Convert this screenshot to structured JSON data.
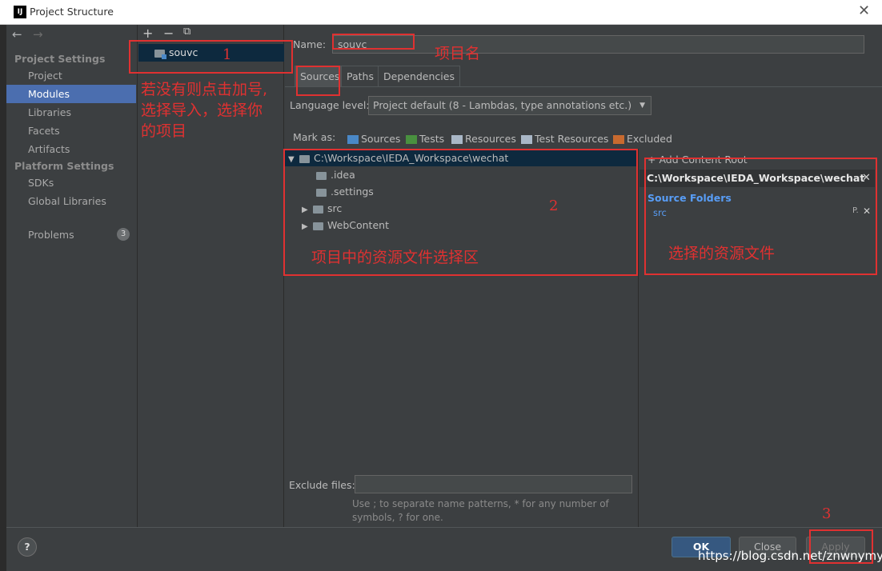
{
  "window": {
    "app_icon_text": "IJ",
    "title": "Project Structure",
    "close_glyph": "✕"
  },
  "nav": {
    "back": "←",
    "forward": "→",
    "project_settings_title": "Project Settings",
    "project_settings": [
      "Project",
      "Modules",
      "Libraries",
      "Facets",
      "Artifacts"
    ],
    "platform_settings_title": "Platform Settings",
    "platform_settings": [
      "SDKs",
      "Global Libraries"
    ],
    "problems_label": "Problems",
    "problems_count": "3",
    "selected": "Modules"
  },
  "modules": {
    "toolbar": {
      "add": "+",
      "remove": "−",
      "copy": "⧉"
    },
    "items": [
      "souvc"
    ]
  },
  "module_settings": {
    "name_label": "Name:",
    "name_value": "souvc",
    "tabs": [
      "Sources",
      "Paths",
      "Dependencies"
    ],
    "active_tab": "Sources",
    "language_level_label": "Language level:",
    "language_level_value": "Project default (8 - Lambdas, type annotations etc.)",
    "mark_as_label": "Mark as:",
    "mark_as": [
      {
        "label": "Sources",
        "color": "#4a88c7"
      },
      {
        "label": "Tests",
        "color": "#49903f"
      },
      {
        "label": "Resources",
        "color": "#a9b7c6"
      },
      {
        "label": "Test Resources",
        "color": "#a9b7c6"
      },
      {
        "label": "Excluded",
        "color": "#c86a2f"
      }
    ],
    "tree": {
      "root": "C:\\Workspace\\IEDA_Workspace\\wechat",
      "children": [
        ".idea",
        ".settings",
        "src",
        "WebContent"
      ]
    },
    "content_root": {
      "add_label": "Add Content Root",
      "path": "C:\\Workspace\\IEDA_Workspace\\wechat",
      "source_folders_title": "Source Folders",
      "source_folders": [
        "src"
      ]
    },
    "exclude_files_label": "Exclude files:",
    "exclude_files_value": "",
    "exclude_hint_line1": "Use ; to separate name patterns, * for any number of",
    "exclude_hint_line2": "symbols, ? for one."
  },
  "footer": {
    "help": "?",
    "ok": "OK",
    "close": "Close",
    "apply": "Apply"
  },
  "annotations": {
    "num1": "1",
    "num2": "2",
    "num3": "3",
    "project_name": "项目名",
    "add_hint_line1": "若没有则点击加号,",
    "add_hint_line2": "选择导入，选择你",
    "add_hint_line3": "的项目",
    "tree_hint": "项目中的资源文件选择区",
    "selected_hint": "选择的资源文件"
  },
  "watermark": "https://blog.csdn.net/znwnymys"
}
